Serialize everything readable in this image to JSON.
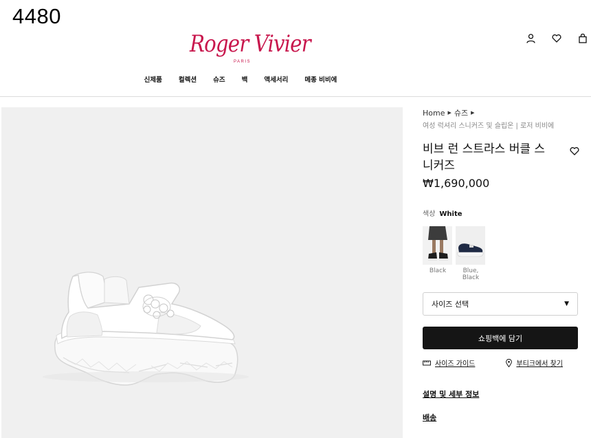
{
  "overlay": {
    "number": "4480"
  },
  "brand": {
    "name": "Roger Vivier",
    "sub": "PARIS",
    "color": "#c8174d"
  },
  "header_icons": [
    "account-icon",
    "wishlist-heart-icon",
    "shopping-bag-icon"
  ],
  "nav": [
    "신제품",
    "컬렉션",
    "슈즈",
    "백",
    "액세서리",
    "메종 비비에"
  ],
  "breadcrumb": {
    "items": [
      "Home",
      "슈즈"
    ],
    "current": "여성 럭셔리 스니커즈 및 슬립온 | 로저 비비에"
  },
  "product": {
    "title": "비브 런 스트라스 버클 스니커즈",
    "price": "₩1,690,000",
    "color_label": "색상",
    "color_value": "White",
    "swatches": [
      {
        "label": "Black"
      },
      {
        "label": "Blue, Black"
      }
    ],
    "size_placeholder": "사이즈 선택",
    "add_to_bag": "쇼핑백에 담기",
    "size_guide": "사이즈 가이드",
    "find_store": "부티크에서 찾기",
    "details_link": "설명 및 세부 정보",
    "shipping_link": "배송"
  }
}
